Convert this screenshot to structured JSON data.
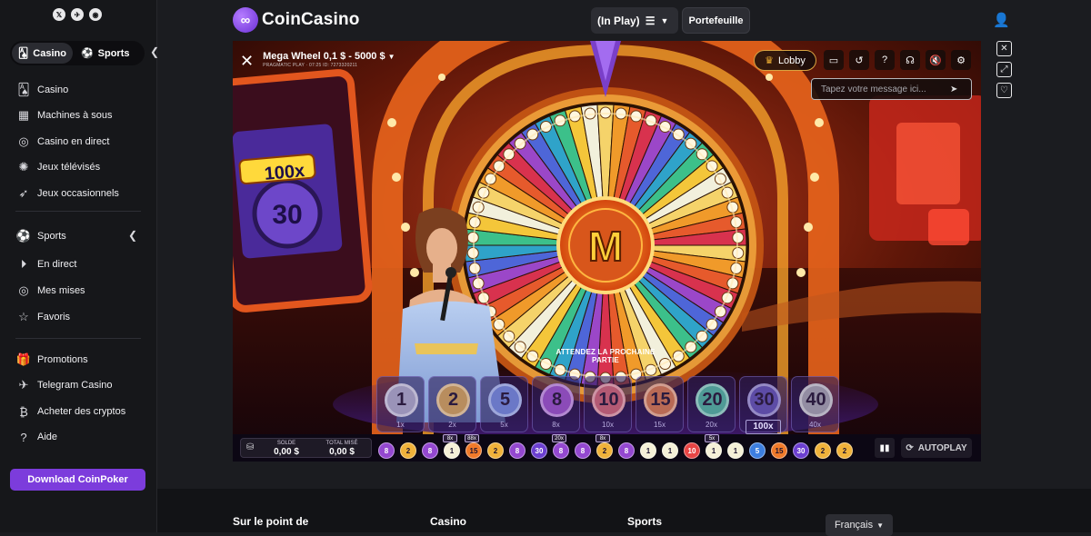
{
  "social": {
    "x": "𝕏",
    "telegram": "✈",
    "discord": "◉"
  },
  "switcher": {
    "casino": "Casino",
    "sports": "Sports"
  },
  "nav": {
    "group1": [
      "Casino",
      "Machines à sous",
      "Casino en direct",
      "Jeux télévisés",
      "Jeux occasionnels"
    ],
    "group2": [
      "Sports",
      "En direct",
      "Mes mises",
      "Favoris"
    ],
    "group3": [
      "Promotions",
      "Telegram Casino",
      "Acheter des cryptos",
      "Aide"
    ]
  },
  "download": "Download CoinPoker",
  "header": {
    "logo_text": "CoinCasino",
    "inplay_label": "(In Play)",
    "wallet_label": "Portefeuille"
  },
  "game": {
    "title": "Mega Wheel 0,1 $ - 5000 $",
    "subtitle": "PRAGMATIC PLAY · 07:25  ID: 7273320211",
    "lobby_label": "Lobby",
    "chat_placeholder": "Tapez votre message ici...",
    "wait_text": "ATTENDEZ LA PROCHAINE PARTIE",
    "wheel_center": "M",
    "side_sign_mult": "100x",
    "side_sign_num": "30",
    "bets": [
      {
        "num": "1",
        "mult": "1x",
        "color": "#9a93b8"
      },
      {
        "num": "2",
        "mult": "2x",
        "color": "#b88d5e"
      },
      {
        "num": "5",
        "mult": "5x",
        "color": "#6b78c7"
      },
      {
        "num": "8",
        "mult": "8x",
        "color": "#8b4bb8"
      },
      {
        "num": "10",
        "mult": "10x",
        "color": "#b35a74"
      },
      {
        "num": "15",
        "mult": "15x",
        "color": "#b96a55"
      },
      {
        "num": "20",
        "mult": "20x",
        "color": "#4f9a96"
      },
      {
        "num": "30",
        "mult": "100x",
        "color": "#5d4ca6",
        "boosted": true
      },
      {
        "num": "40",
        "mult": "40x",
        "color": "#938da3"
      }
    ],
    "balance_label": "SOLDE",
    "balance_value": "0,00 $",
    "total_label": "TOTAL MISÉ",
    "total_value": "0,00 $",
    "autoplay_label": "AUTOPLAY",
    "history": [
      {
        "n": "8",
        "c": "#9448d0"
      },
      {
        "n": "2",
        "c": "#f0b23b"
      },
      {
        "n": "8",
        "c": "#9448d0"
      },
      {
        "n": "1",
        "c": "#f5f0d8",
        "tag": "8x"
      },
      {
        "n": "15",
        "c": "#f07a2a",
        "tag": "88x"
      },
      {
        "n": "2",
        "c": "#f0b23b"
      },
      {
        "n": "8",
        "c": "#9448d0"
      },
      {
        "n": "30",
        "c": "#6c3fd0"
      },
      {
        "n": "8",
        "c": "#9448d0",
        "tag": "20x"
      },
      {
        "n": "8",
        "c": "#9448d0"
      },
      {
        "n": "2",
        "c": "#f0b23b",
        "tag": "8x"
      },
      {
        "n": "8",
        "c": "#9448d0"
      },
      {
        "n": "1",
        "c": "#f5f0d8"
      },
      {
        "n": "1",
        "c": "#f5f0d8"
      },
      {
        "n": "10",
        "c": "#e84545"
      },
      {
        "n": "1",
        "c": "#f5f0d8",
        "tag": "5x"
      },
      {
        "n": "1",
        "c": "#f5f0d8"
      },
      {
        "n": "5",
        "c": "#3d7ee0"
      },
      {
        "n": "15",
        "c": "#f07a2a"
      },
      {
        "n": "30",
        "c": "#6c3fd0"
      },
      {
        "n": "2",
        "c": "#f0b23b"
      },
      {
        "n": "2",
        "c": "#f0b23b"
      }
    ]
  },
  "footer": {
    "col1": "Sur le point de",
    "col2": "Casino",
    "col3": "Sports",
    "lang": "Français"
  }
}
